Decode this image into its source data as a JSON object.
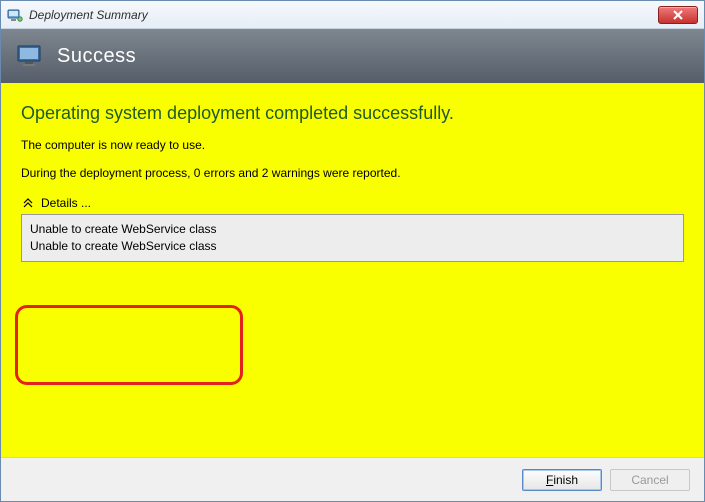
{
  "window": {
    "title": "Deployment Summary"
  },
  "banner": {
    "title": "Success"
  },
  "content": {
    "heading": "Operating system deployment completed successfully.",
    "ready_text": "The computer is now ready to use.",
    "summary_text": "During the deployment process, 0 errors and 2 warnings were reported.",
    "details_label": "Details ...",
    "detail_items": [
      "Unable to create WebService class",
      "Unable to create WebService class"
    ]
  },
  "footer": {
    "finish_label": "Finish",
    "cancel_label": "Cancel"
  },
  "counts": {
    "errors": 0,
    "warnings": 2
  }
}
